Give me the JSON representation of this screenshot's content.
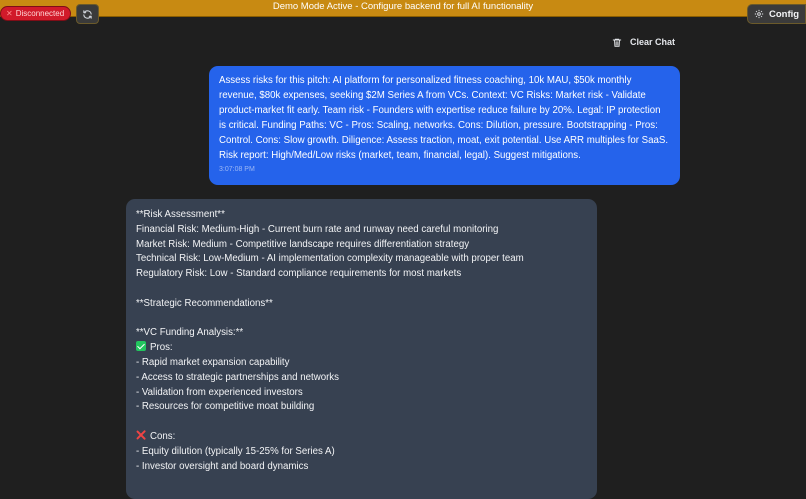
{
  "banner": {
    "text": "Demo Mode Active - Configure backend for full AI functionality"
  },
  "status": {
    "label": "Disconnected",
    "color": "#d11a2a"
  },
  "toolbar": {
    "config_label": "Config",
    "clear_chat_label": "Clear Chat"
  },
  "icons": {
    "refresh": "refresh-icon",
    "gear": "gear-icon",
    "trash": "trash-icon",
    "close": "x-icon"
  },
  "user_message": {
    "text": "Assess risks for this pitch: AI platform for personalized fitness coaching, 10k MAU, $50k monthly revenue, $80k expenses, seeking $2M Series A from VCs. Context: VC Risks: Market risk - Validate product-market fit early. Team risk - Founders with expertise reduce failure by 20%. Legal: IP protection is critical. Funding Paths: VC - Pros: Scaling, networks. Cons: Dilution, pressure. Bootstrapping - Pros: Control. Cons: Slow growth. Diligence: Assess traction, moat, exit potential. Use ARR multiples for SaaS. Risk report: High/Med/Low risks (market, team, financial, legal). Suggest mitigations.",
    "time": "3:07:08 PM"
  },
  "bot_message": {
    "lines": [
      "**Risk Assessment**",
      "Financial Risk: Medium-High - Current burn rate and runway need careful monitoring",
      "Market Risk: Medium - Competitive landscape requires differentiation strategy",
      "Technical Risk: Low-Medium - AI implementation complexity manageable with proper team",
      "Regulatory Risk: Low - Standard compliance requirements for most markets",
      "",
      "**Strategic Recommendations**",
      "",
      "**VC Funding Analysis:**",
      "Pros:",
      "- Rapid market expansion capability",
      "- Access to strategic partnerships and networks",
      "- Validation from experienced investors",
      "- Resources for competitive moat building",
      "",
      "Cons:",
      "- Equity dilution (typically 15-25% for Series A)",
      "- Investor oversight and board dynamics"
    ]
  }
}
